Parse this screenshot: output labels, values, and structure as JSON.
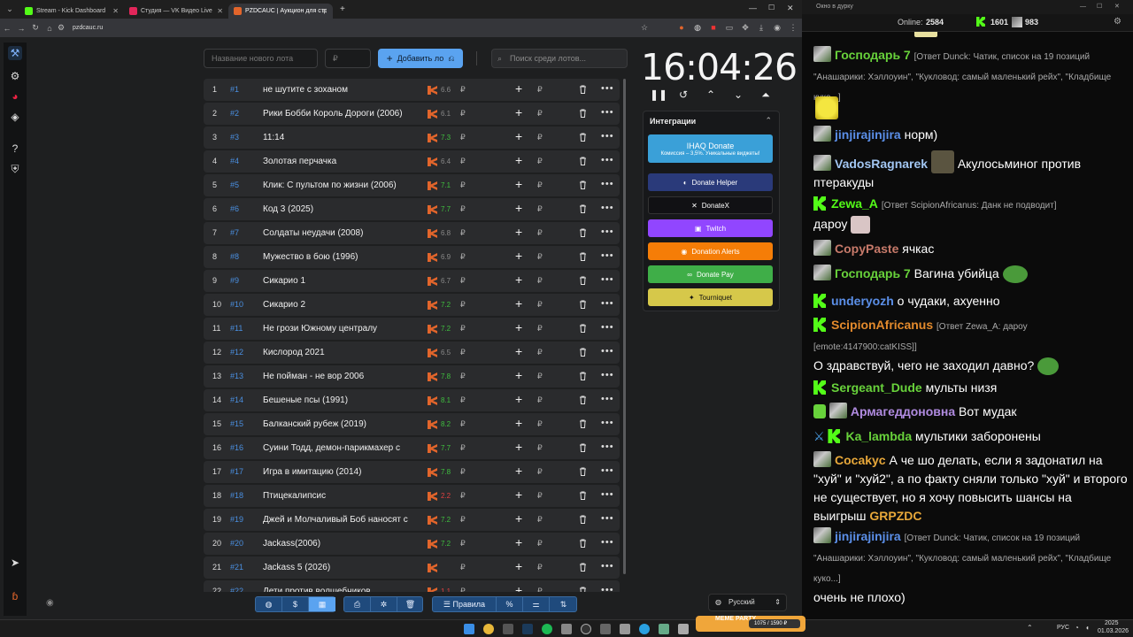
{
  "browser": {
    "tabs": [
      {
        "label": "Stream - Kick Dashboard",
        "color": "#53fc18"
      },
      {
        "label": "Студия — VK Видео Live",
        "color": "#e2265a"
      },
      {
        "label": "PZDCAUC | Аукцион для стри…",
        "color": "#e2652b"
      }
    ],
    "new_tab": "+",
    "url": "pzdcauc.ru"
  },
  "app": {
    "lot_name_placeholder": "Название нового лота",
    "amount_placeholder": "₽",
    "add_button": "Добавить ло",
    "search_placeholder": "Поиск среди лотов...",
    "timer": "16:04:26",
    "integrations_title": "Интеграции",
    "integrations": [
      {
        "label": "IHAQ Donate",
        "sub": "Комиссия – 3,5%. Уникальные виджеты!",
        "color": "#3aa0d8"
      },
      {
        "label": "Donate Helper",
        "color": "#2a3a7a"
      },
      {
        "label": "DonateX",
        "color": "#111114"
      },
      {
        "label": "Twitch",
        "color": "#9146ff"
      },
      {
        "label": "Donation Alerts",
        "color": "#f57d07"
      },
      {
        "label": "Donate Pay",
        "color": "#3fae48"
      },
      {
        "label": "Tourniquet",
        "color": "#d6c84a"
      }
    ],
    "lots": [
      {
        "n": "1",
        "fast": "#1",
        "name": "не шутите с зоханом",
        "rating": "6.6",
        "rc": "#888888"
      },
      {
        "n": "2",
        "fast": "#2",
        "name": "Рики Бобби Король Дороги (2006)",
        "rating": "6.1",
        "rc": "#888888"
      },
      {
        "n": "3",
        "fast": "#3",
        "name": "11:14",
        "rating": "7.3",
        "rc": "#3fbf3f"
      },
      {
        "n": "4",
        "fast": "#4",
        "name": "Золотая перчачка",
        "rating": "6.4",
        "rc": "#888888"
      },
      {
        "n": "5",
        "fast": "#5",
        "name": "Клик: С пультом по жизни (2006)",
        "rating": "7.1",
        "rc": "#3fbf3f"
      },
      {
        "n": "6",
        "fast": "#6",
        "name": "Код 3 (2025)",
        "rating": "7.7",
        "rc": "#3fbf3f"
      },
      {
        "n": "7",
        "fast": "#7",
        "name": "Солдаты неудачи (2008)",
        "rating": "6.8",
        "rc": "#888888"
      },
      {
        "n": "8",
        "fast": "#8",
        "name": "Мужество в бою (1996)",
        "rating": "6.9",
        "rc": "#888888"
      },
      {
        "n": "9",
        "fast": "#9",
        "name": "Сикарио 1",
        "rating": "6.7",
        "rc": "#888888"
      },
      {
        "n": "10",
        "fast": "#10",
        "name": "Сикарио 2",
        "rating": "7.2",
        "rc": "#3fbf3f"
      },
      {
        "n": "11",
        "fast": "#11",
        "name": "Не грози Южному централу",
        "rating": "7.2",
        "rc": "#3fbf3f"
      },
      {
        "n": "12",
        "fast": "#12",
        "name": "Кислород 2021",
        "rating": "6.5",
        "rc": "#888888"
      },
      {
        "n": "13",
        "fast": "#13",
        "name": "Не пойман - не вор 2006",
        "rating": "7.8",
        "rc": "#3fbf3f"
      },
      {
        "n": "14",
        "fast": "#14",
        "name": "Бешеные псы (1991)",
        "rating": "8.1",
        "rc": "#3fbf3f"
      },
      {
        "n": "15",
        "fast": "#15",
        "name": "Балканский рубеж (2019)",
        "rating": "8.2",
        "rc": "#3fbf3f"
      },
      {
        "n": "16",
        "fast": "#16",
        "name": "Суини Тодд, демон-парикмахер с",
        "rating": "7.7",
        "rc": "#3fbf3f"
      },
      {
        "n": "17",
        "fast": "#17",
        "name": "Игра в имитацию (2014)",
        "rating": "7.8",
        "rc": "#3fbf3f"
      },
      {
        "n": "18",
        "fast": "#18",
        "name": "Птицекалипсис",
        "rating": "2.2",
        "rc": "#e24040"
      },
      {
        "n": "19",
        "fast": "#19",
        "name": "Джей и Молчаливый Боб наносят с",
        "rating": "7.2",
        "rc": "#3fbf3f"
      },
      {
        "n": "20",
        "fast": "#20",
        "name": "Jackass(2006)",
        "rating": "7.2",
        "rc": "#3fbf3f"
      },
      {
        "n": "21",
        "fast": "#21",
        "name": "Jackass 5 (2026)",
        "rating": "",
        "rc": "#888888"
      },
      {
        "n": "22",
        "fast": "#22",
        "name": "Дети против волшебников",
        "rating": "1.1",
        "rc": "#e24040"
      }
    ],
    "currency": "₽",
    "rules_label": "Правила",
    "language": "Русский"
  },
  "chat": {
    "window_title": "Окно в дурку",
    "online_label": "Online:",
    "online": "2584",
    "kick_viewers": "1601",
    "vk_viewers": "983",
    "messages": [
      {
        "user": "Господарь 7",
        "color": "#68d23b",
        "reply": "[Ответ Dunck: Чатик, список на 19 позиций  \"Анашарики: Хэллоуин\", \"Кукловод: самый маленький рейх\", \"Кладбище куко...]",
        "text": ""
      },
      {
        "user": "jinjirajinjira",
        "color": "#5b8fe8",
        "reply": "",
        "text": "норм)"
      },
      {
        "user": "VadosRagnarek",
        "color": "#a2c6f2",
        "reply": "",
        "text": "Акулосьминог против птеракуды"
      },
      {
        "user": "Zewa_A",
        "color": "#53fc18",
        "reply": "[Ответ ScipionAfricanus: Данк не подводит]",
        "text": "дароу"
      },
      {
        "user": "CopyPaste",
        "color": "#c77a6a",
        "reply": "",
        "text": "ячкас"
      },
      {
        "user": "Господарь 7",
        "color": "#68d23b",
        "reply": "",
        "text": "Вагина убийца"
      },
      {
        "user": "underyozh",
        "color": "#5b8fe8",
        "reply": "",
        "text": "о чудаки, ахуенно"
      },
      {
        "user": "ScipionAfricanus",
        "color": "#e38a2c",
        "reply": "[Ответ Zewa_A: дароу [emote:4147900:catKISS]]",
        "text": "О здравствуй, чего не заходил давно?"
      },
      {
        "user": "Sergeant_Dude",
        "color": "#68d23b",
        "reply": "",
        "text": "мульты низя"
      },
      {
        "user": "Армагеддоновна",
        "color": "#b08be0",
        "reply": "",
        "text": "Вот мудак"
      },
      {
        "user": "Ka_lambda",
        "color": "#68d23b",
        "reply": "",
        "text": "мультики заборонены"
      },
      {
        "user": "Cocakyc",
        "color": "#e8a83a",
        "reply": "",
        "text": "А че шо делать, если я задонатил на \"хуй\" и \"хуй2\", а по факту сняли только \"хуй\" и второго не существует, но я хочу повысить шансы на выигрыш",
        "highlight": "GRPZDC"
      },
      {
        "user": "jinjirajinjira",
        "color": "#5b8fe8",
        "reply": "[Ответ Dunck: Чатик, список на 19 позиций  \"Анашарики: Хэллоуин\", \"Кукловод: самый маленький рейх\", \"Кладбище куко...]",
        "text": "очень не плохо)"
      }
    ]
  },
  "taskbar": {
    "lang": "РУС",
    "time": "2025",
    "date": "01.03.2026",
    "widget_label": "MEME PARTY",
    "widget_value": "1075 / 1590 ₽"
  }
}
